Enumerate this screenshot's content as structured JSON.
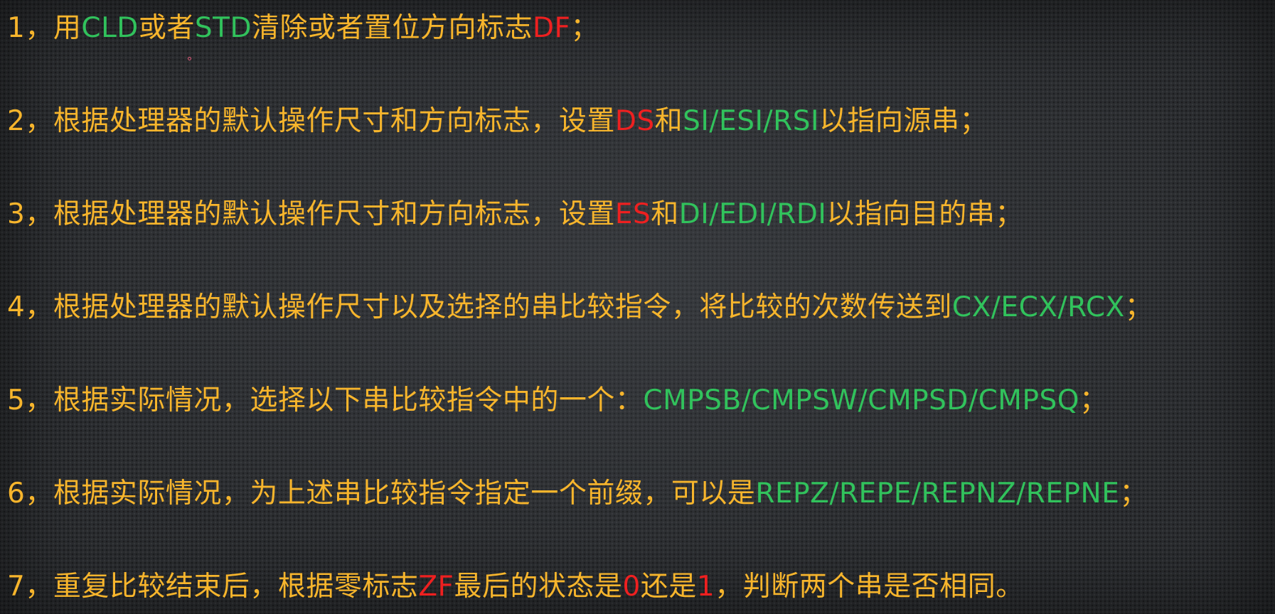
{
  "steps": [
    {
      "number": "1，",
      "parts": [
        "用",
        "CLD",
        "或者",
        "STD",
        "清除或者置位方向标志",
        "DF",
        "；"
      ]
    },
    {
      "number": "2，",
      "parts": [
        "根据处理器的默认操作尺寸和方向标志，设置",
        "DS",
        "和",
        "SI/ESI/RSI",
        "以指向源串；"
      ]
    },
    {
      "number": "3，",
      "parts": [
        "根据处理器的默认操作尺寸和方向标志，设置",
        "ES",
        "和",
        "DI/EDI/RDI",
        "以指向目的串；"
      ]
    },
    {
      "number": "4，",
      "parts": [
        "根据处理器的默认操作尺寸以及选择的串比较指令，将比较的次数传送到",
        "CX/ECX/RCX",
        "；"
      ]
    },
    {
      "number": "5，",
      "parts": [
        "根据实际情况，选择以下串比较指令中的一个：",
        "CMPSB/CMPSW/CMPSD/CMPSQ",
        "；"
      ]
    },
    {
      "number": "6，",
      "parts": [
        "根据实际情况，为上述串比较指令指定一个前缀，可以是",
        "REPZ/REPE/REPNZ/REPNE",
        "；"
      ]
    },
    {
      "number": "7，",
      "parts": [
        "重复比较结束后，根据零标志",
        "ZF",
        "最后的状态是",
        "0",
        "还是",
        "1",
        "，判断两个串是否相同。"
      ]
    }
  ],
  "colors": {
    "text": "#f7b52c",
    "highlight_green": "#31c25c",
    "highlight_red": "#ee2020",
    "background": "#2b2d30"
  }
}
